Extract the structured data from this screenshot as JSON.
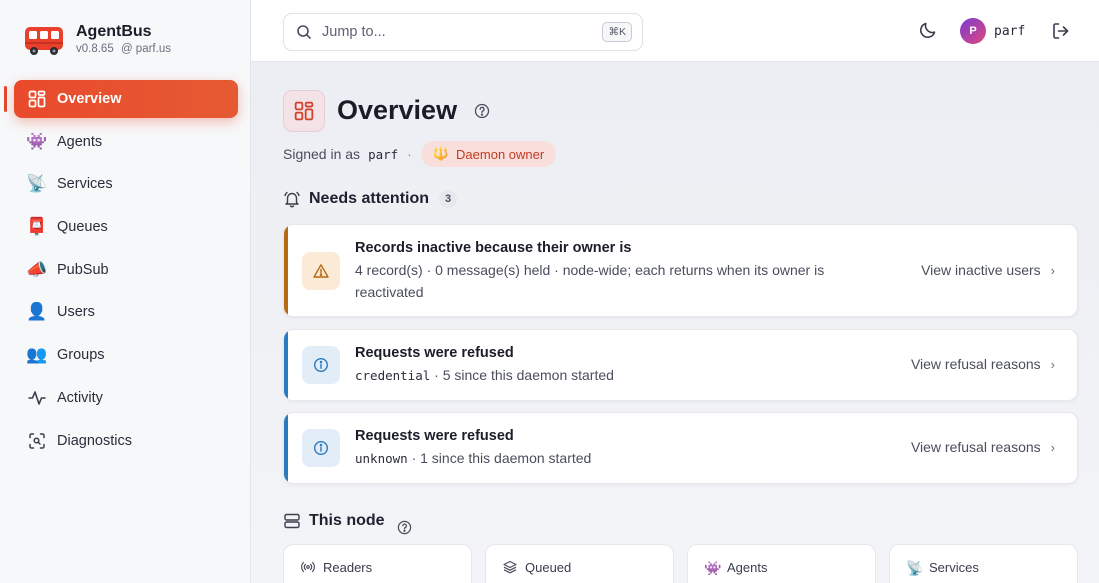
{
  "app": {
    "name": "AgentBus",
    "version": "v0.8.65",
    "host": "@ parf.us"
  },
  "sidebar": {
    "items": [
      {
        "label": "Overview",
        "icon": "grid-icon",
        "active": true
      },
      {
        "label": "Agents",
        "icon": "👾"
      },
      {
        "label": "Services",
        "icon": "📡"
      },
      {
        "label": "Queues",
        "icon": "📮"
      },
      {
        "label": "PubSub",
        "icon": "📣"
      },
      {
        "label": "Users",
        "icon": "👤"
      },
      {
        "label": "Groups",
        "icon": "👥"
      },
      {
        "label": "Activity",
        "icon": "activity-icon"
      },
      {
        "label": "Diagnostics",
        "icon": "scan-icon"
      }
    ]
  },
  "header": {
    "search_placeholder": "Jump to...",
    "shortcut": "⌘K",
    "avatar_letter": "P",
    "username": "parf"
  },
  "page": {
    "title": "Overview",
    "signed_in_label": "Signed in as",
    "signed_in_user": "parf",
    "separator": "·",
    "role_icon": "🔱",
    "role": "Daemon owner"
  },
  "attention": {
    "title": "Needs attention",
    "count": "3",
    "cards": [
      {
        "severity": "warning",
        "color": "#b86a12",
        "title": "Records inactive because their owner is",
        "desc_line1": "4 record(s) · 0 message(s) held · node-wide; each returns when its owner is",
        "desc_line2": "reactivated",
        "action": "View inactive users"
      },
      {
        "severity": "info",
        "color": "#2a7ac0",
        "title": "Requests were refused",
        "code": "credential",
        "desc": " · 5 since this daemon started",
        "action": "View refusal reasons"
      },
      {
        "severity": "info",
        "color": "#2a7ac0",
        "title": "Requests were refused",
        "code": "unknown",
        "desc": " · 1 since this daemon started",
        "action": "View refusal reasons"
      }
    ]
  },
  "node": {
    "title": "This node",
    "stats": [
      {
        "label": "Readers",
        "icon": "radio-icon"
      },
      {
        "label": "Queued",
        "icon": "layers-icon"
      },
      {
        "label": "Agents",
        "icon": "👾"
      },
      {
        "label": "Services",
        "icon": "📡"
      }
    ]
  }
}
